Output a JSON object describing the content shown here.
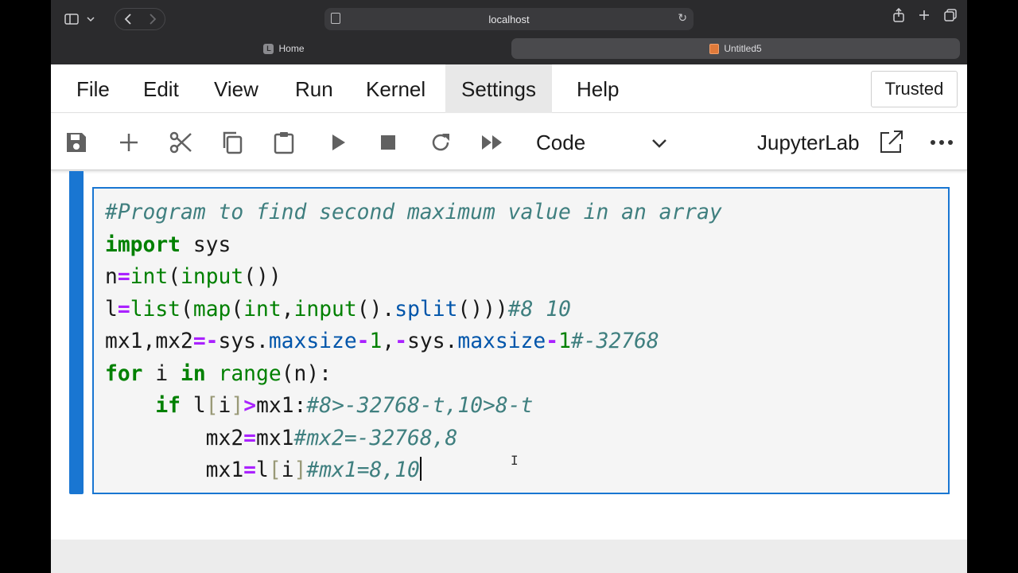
{
  "browser": {
    "url": "localhost",
    "tabs": [
      {
        "label": "Home",
        "favicon": "L"
      },
      {
        "label": "Untitled5"
      }
    ]
  },
  "menubar": {
    "items": [
      "File",
      "Edit",
      "View",
      "Run",
      "Kernel",
      "Settings",
      "Help"
    ],
    "trusted_label": "Trusted"
  },
  "toolbar": {
    "cell_type": "Code",
    "kernel_label": "JupyterLab",
    "icons": [
      "save-icon",
      "add-cell-icon",
      "cut-icon",
      "copy-icon",
      "paste-icon",
      "run-icon",
      "stop-icon",
      "restart-icon",
      "fast-forward-icon",
      "chevron-down-icon",
      "open-external-icon",
      "more-icon"
    ]
  },
  "cell": {
    "lines": [
      [
        {
          "t": "#Program to find second maximum value in an array",
          "k": "comment"
        }
      ],
      [
        {
          "t": "import",
          "k": "kw"
        },
        {
          "t": " sys",
          "k": "plain"
        }
      ],
      [
        {
          "t": "n",
          "k": "plain"
        },
        {
          "t": "=",
          "k": "op"
        },
        {
          "t": "int",
          "k": "builtin"
        },
        {
          "t": "(",
          "k": "plain"
        },
        {
          "t": "input",
          "k": "builtin"
        },
        {
          "t": "())",
          "k": "plain"
        }
      ],
      [
        {
          "t": "l",
          "k": "plain"
        },
        {
          "t": "=",
          "k": "op"
        },
        {
          "t": "list",
          "k": "builtin"
        },
        {
          "t": "(",
          "k": "plain"
        },
        {
          "t": "map",
          "k": "builtin"
        },
        {
          "t": "(",
          "k": "plain"
        },
        {
          "t": "int",
          "k": "builtin"
        },
        {
          "t": ",",
          "k": "plain"
        },
        {
          "t": "input",
          "k": "builtin"
        },
        {
          "t": "().",
          "k": "plain"
        },
        {
          "t": "split",
          "k": "attr"
        },
        {
          "t": "()))",
          "k": "plain"
        },
        {
          "t": "#8 10",
          "k": "comment"
        }
      ],
      [
        {
          "t": "mx1,mx2",
          "k": "plain"
        },
        {
          "t": "=-",
          "k": "op"
        },
        {
          "t": "sys.",
          "k": "plain"
        },
        {
          "t": "maxsize",
          "k": "attr"
        },
        {
          "t": "-",
          "k": "op"
        },
        {
          "t": "1",
          "k": "num"
        },
        {
          "t": ",",
          "k": "plain"
        },
        {
          "t": "-",
          "k": "op"
        },
        {
          "t": "sys.",
          "k": "plain"
        },
        {
          "t": "maxsize",
          "k": "attr"
        },
        {
          "t": "-",
          "k": "op"
        },
        {
          "t": "1",
          "k": "num"
        },
        {
          "t": "#-32768",
          "k": "comment"
        }
      ],
      [
        {
          "t": "for",
          "k": "kw"
        },
        {
          "t": " i ",
          "k": "plain"
        },
        {
          "t": "in",
          "k": "kw"
        },
        {
          "t": " ",
          "k": "plain"
        },
        {
          "t": "range",
          "k": "builtin"
        },
        {
          "t": "(n):",
          "k": "plain"
        }
      ],
      [
        {
          "t": "    ",
          "k": "plain"
        },
        {
          "t": "if",
          "k": "kw"
        },
        {
          "t": " l",
          "k": "plain"
        },
        {
          "t": "[",
          "k": "bracket"
        },
        {
          "t": "i",
          "k": "plain"
        },
        {
          "t": "]",
          "k": "bracket"
        },
        {
          "t": ">",
          "k": "op"
        },
        {
          "t": "mx1:",
          "k": "plain"
        },
        {
          "t": "#8>-32768-t,10>8-t",
          "k": "comment"
        }
      ],
      [
        {
          "t": "        mx2",
          "k": "plain"
        },
        {
          "t": "=",
          "k": "op"
        },
        {
          "t": "mx1",
          "k": "plain"
        },
        {
          "t": "#mx2=-32768,8",
          "k": "comment"
        }
      ],
      [
        {
          "t": "        mx1",
          "k": "plain"
        },
        {
          "t": "=",
          "k": "op"
        },
        {
          "t": "l",
          "k": "plain"
        },
        {
          "t": "[",
          "k": "bracket"
        },
        {
          "t": "i",
          "k": "plain"
        },
        {
          "t": "]",
          "k": "bracket"
        },
        {
          "t": "#mx1=8,10",
          "k": "comment"
        }
      ]
    ]
  },
  "colors": {
    "accent": "#1976d2",
    "comment": "#3f7f7f",
    "keyword": "#008000",
    "operator": "#aa22ff"
  }
}
